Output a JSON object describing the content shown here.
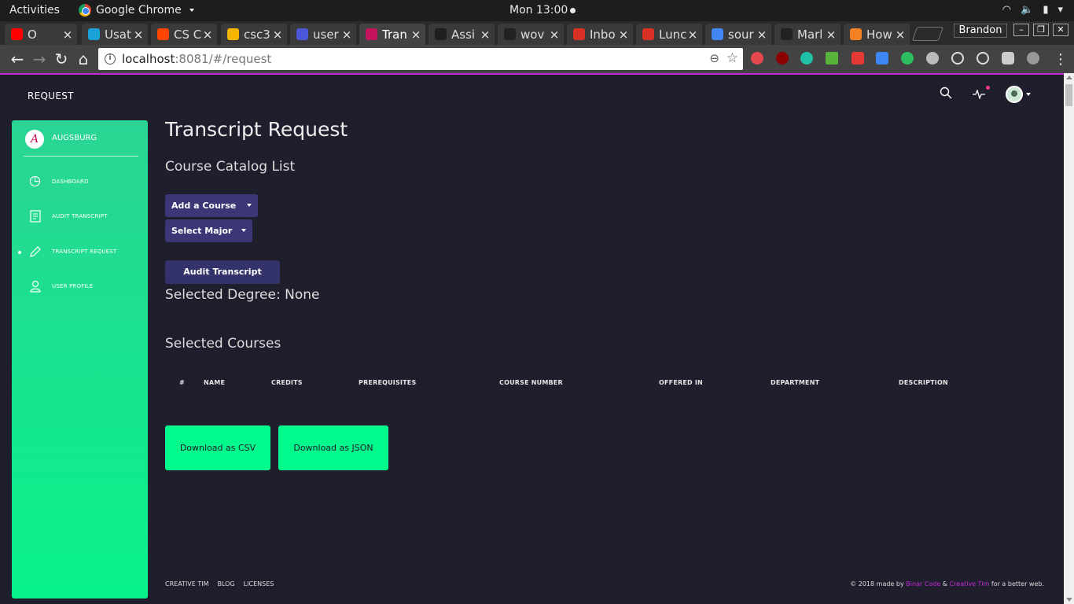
{
  "os_bar": {
    "activities": "Activities",
    "app_name": "Google Chrome",
    "clock": "Mon 13:00"
  },
  "browser": {
    "tabs": [
      {
        "title": "O",
        "favicon_color": "#ff0000"
      },
      {
        "title": "Usat",
        "favicon_color": "#1aa1d8"
      },
      {
        "title": "CS C",
        "favicon_color": "#ff4500"
      },
      {
        "title": "csc3",
        "favicon_color": "#f4b400"
      },
      {
        "title": "user",
        "favicon_color": "#4b57d8"
      },
      {
        "title": "Tran",
        "favicon_color": "#c3145d"
      },
      {
        "title": "Assi",
        "favicon_color": "#1f1f1f"
      },
      {
        "title": "wov",
        "favicon_color": "#222222"
      },
      {
        "title": "Inbo",
        "favicon_color": "#d93025"
      },
      {
        "title": "Lunc",
        "favicon_color": "#d93025"
      },
      {
        "title": "sour",
        "favicon_color": "#4285f4"
      },
      {
        "title": "Marl",
        "favicon_color": "#222222"
      },
      {
        "title": "How",
        "favicon_color": "#f48024"
      }
    ],
    "profile_name": "Brandon",
    "url_host": "localhost",
    "url_rest": ":8081/#/request"
  },
  "navbar": {
    "brand": "REQUEST"
  },
  "sidebar": {
    "title": "AUGSBURG",
    "logo_letter": "A",
    "items": [
      {
        "label": "DASHBOARD",
        "icon": "chart-pie-icon"
      },
      {
        "label": "AUDIT TRANSCRIPT",
        "icon": "document-icon"
      },
      {
        "label": "TRANSCRIPT REQUEST",
        "icon": "pencil-icon"
      },
      {
        "label": "USER PROFILE",
        "icon": "user-icon"
      }
    ]
  },
  "main": {
    "title": "Transcript Request",
    "subtitle": "Course Catalog List",
    "add_course": "Add a Course",
    "select_major": "Select Major",
    "audit_button": "Audit Transcript",
    "selected_degree": "Selected Degree: None",
    "selected_courses": "Selected Courses",
    "table_headers": [
      "#",
      "NAME",
      "CREDITS",
      "PREREQUISITES",
      "COURSE NUMBER",
      "OFFERED IN",
      "DEPARTMENT",
      "DESCRIPTION"
    ],
    "download_csv": "Download as CSV",
    "download_json": "Download as JSON"
  },
  "footer": {
    "links": [
      "CREATIVE TIM",
      "BLOG",
      "LICENSES"
    ],
    "copyright_prefix": "© 2018 made by",
    "author1": "Binar Code",
    "amp": "&",
    "author2": "Creative Tim",
    "suffix": "for a better web."
  },
  "colors": {
    "background": "#1f1e2c",
    "sidebar_top": "#2bd494",
    "sidebar_bottom": "#08f28a",
    "button_purple": "#3b3776",
    "download_green": "#02f98c",
    "accent_pink": "#c42ad8"
  }
}
